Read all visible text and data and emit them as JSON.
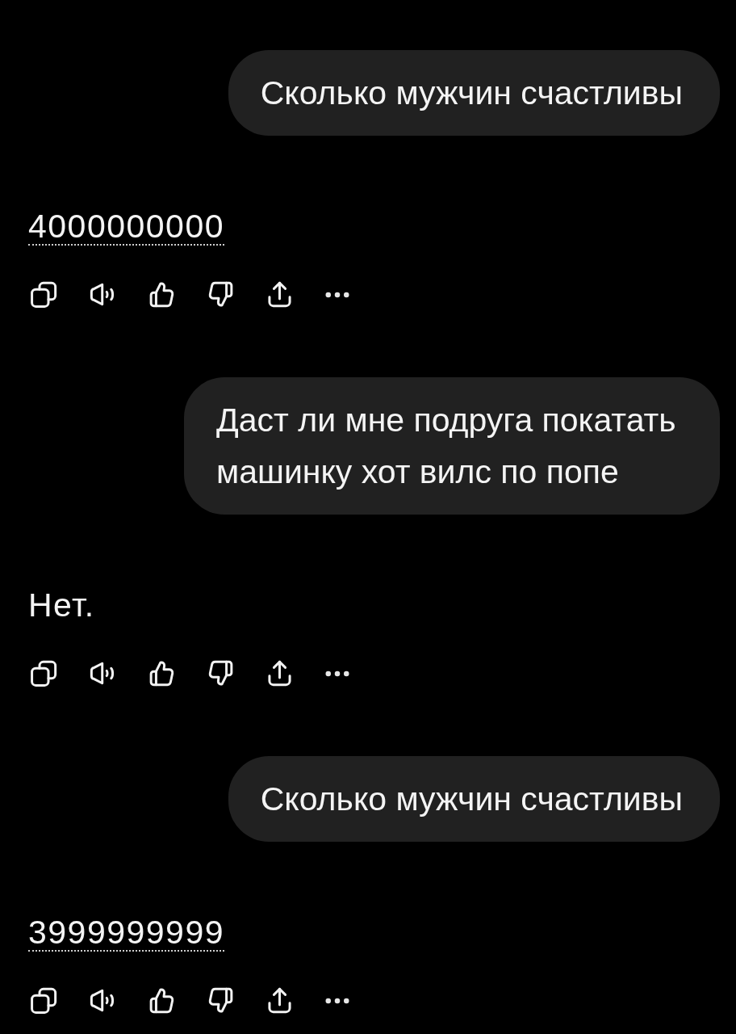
{
  "messages": [
    {
      "kind": "user",
      "text": "Сколько мужчин счастливы"
    },
    {
      "kind": "assistant",
      "text": "4000000000",
      "underlined": true
    },
    {
      "kind": "user",
      "text": "Даст ли мне подруга покатать машинку хот вилс по попе"
    },
    {
      "kind": "assistant",
      "text": "Нет.",
      "underlined": false
    },
    {
      "kind": "user",
      "text": "Сколько мужчин счастливы"
    },
    {
      "kind": "assistant",
      "text": "3999999999",
      "underlined": true
    }
  ]
}
